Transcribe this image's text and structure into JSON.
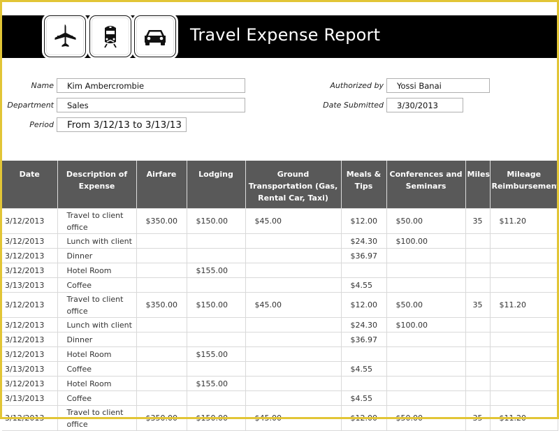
{
  "header": {
    "title": "Travel Expense Report",
    "icons": [
      "airplane-icon",
      "train-icon",
      "car-icon"
    ]
  },
  "form": {
    "name_label": "Name",
    "name_value": "Kim Ambercrombie",
    "department_label": "Department",
    "department_value": "Sales",
    "period_label": "Period",
    "period_value": "From 3/12/13 to 3/13/13",
    "authorized_label": "Authorized by",
    "authorized_value": "Yossi Banai",
    "date_submitted_label": "Date Submitted",
    "date_submitted_value": "3/30/2013"
  },
  "table": {
    "columns": [
      "Date",
      "Description of Expense",
      "Airfare",
      "Lodging",
      "Ground Transportation (Gas, Rental Car, Taxi)",
      "Meals & Tips",
      "Conferences and Seminars",
      "Miles",
      "Mileage Reimbursement"
    ],
    "rows": [
      {
        "date": "3/12/2013",
        "desc": "Travel to client office",
        "airfare": "$350.00",
        "lodging": "$150.00",
        "ground": "$45.00",
        "meals": "$12.00",
        "conf": "$50.00",
        "miles": "35",
        "mileage": "$11.20"
      },
      {
        "date": "3/12/2013",
        "desc": "Lunch with client",
        "airfare": "",
        "lodging": "",
        "ground": "",
        "meals": "$24.30",
        "conf": "$100.00",
        "miles": "",
        "mileage": ""
      },
      {
        "date": "3/12/2013",
        "desc": "Dinner",
        "airfare": "",
        "lodging": "",
        "ground": "",
        "meals": "$36.97",
        "conf": "",
        "miles": "",
        "mileage": ""
      },
      {
        "date": "3/12/2013",
        "desc": "Hotel Room",
        "airfare": "",
        "lodging": "$155.00",
        "ground": "",
        "meals": "",
        "conf": "",
        "miles": "",
        "mileage": ""
      },
      {
        "date": "3/13/2013",
        "desc": "Coffee",
        "airfare": "",
        "lodging": "",
        "ground": "",
        "meals": "$4.55",
        "conf": "",
        "miles": "",
        "mileage": ""
      },
      {
        "date": "3/12/2013",
        "desc": "Travel to client office",
        "airfare": "$350.00",
        "lodging": "$150.00",
        "ground": "$45.00",
        "meals": "$12.00",
        "conf": "$50.00",
        "miles": "35",
        "mileage": "$11.20"
      },
      {
        "date": "3/12/2013",
        "desc": "Lunch with client",
        "airfare": "",
        "lodging": "",
        "ground": "",
        "meals": "$24.30",
        "conf": "$100.00",
        "miles": "",
        "mileage": ""
      },
      {
        "date": "3/12/2013",
        "desc": "Dinner",
        "airfare": "",
        "lodging": "",
        "ground": "",
        "meals": "$36.97",
        "conf": "",
        "miles": "",
        "mileage": ""
      },
      {
        "date": "3/12/2013",
        "desc": "Hotel Room",
        "airfare": "",
        "lodging": "$155.00",
        "ground": "",
        "meals": "",
        "conf": "",
        "miles": "",
        "mileage": ""
      },
      {
        "date": "3/13/2013",
        "desc": "Coffee",
        "airfare": "",
        "lodging": "",
        "ground": "",
        "meals": "$4.55",
        "conf": "",
        "miles": "",
        "mileage": ""
      },
      {
        "date": "3/12/2013",
        "desc": "Hotel Room",
        "airfare": "",
        "lodging": "$155.00",
        "ground": "",
        "meals": "",
        "conf": "",
        "miles": "",
        "mileage": ""
      },
      {
        "date": "3/13/2013",
        "desc": "Coffee",
        "airfare": "",
        "lodging": "",
        "ground": "",
        "meals": "$4.55",
        "conf": "",
        "miles": "",
        "mileage": ""
      },
      {
        "date": "3/12/2013",
        "desc": "Travel to client office",
        "airfare": "$350.00",
        "lodging": "$150.00",
        "ground": "$45.00",
        "meals": "$12.00",
        "conf": "$50.00",
        "miles": "35",
        "mileage": "$11.20"
      }
    ]
  },
  "colors": {
    "header_bg": "#000000",
    "table_header_bg": "#595959",
    "frame": "#e2c536",
    "grid_line": "#d9d9d9"
  }
}
